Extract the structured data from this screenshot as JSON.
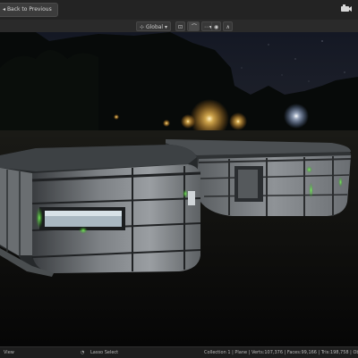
{
  "header": {
    "back_button_label": "Back to Previous",
    "back_button_icon": "arrow-left-icon"
  },
  "toolbar": {
    "transform_orientation": "Global",
    "pivot_icon": "pivot-point-icon",
    "snap_icon": "snap-magnet-icon",
    "proportional_icon": "proportional-edit-icon"
  },
  "status": {
    "left_label": "View",
    "lasso_label": "Lasso Select",
    "stats": "Collection 1 | Plane | Verts:107,376 | Faces:99,166 | Tris:198,758 | Objects"
  },
  "colors": {
    "accent_green": "#3cff3c",
    "lamp_warm": "#ffd27a",
    "lamp_cool": "#e8f2ff"
  }
}
